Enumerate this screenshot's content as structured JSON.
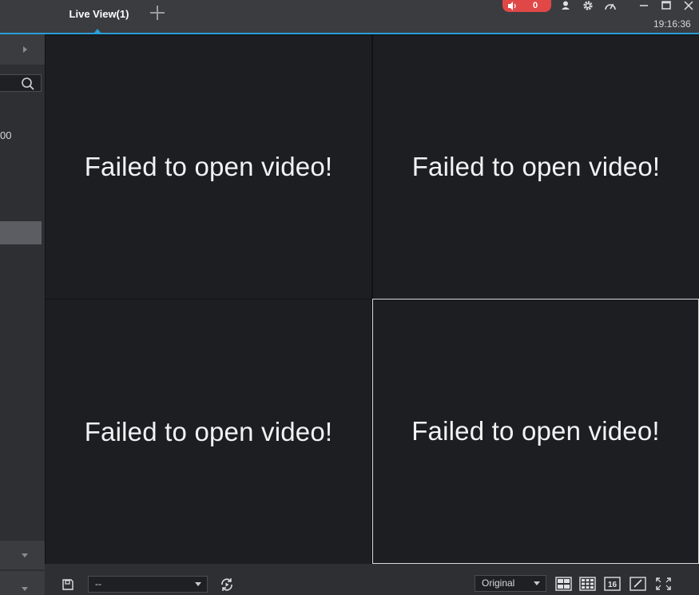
{
  "titlebar": {
    "tab_label": "Live View(1)",
    "alarm_count": "0",
    "clock": "19:16:36"
  },
  "left_panel": {
    "tree_item_text": "00"
  },
  "video_cells": [
    {
      "message": "Failed to open video!"
    },
    {
      "message": "Failed to open video!"
    },
    {
      "message": "Failed to open video!"
    },
    {
      "message": "Failed to open video!"
    }
  ],
  "bottom_bar": {
    "view_select_value": "--",
    "stream_select_value": "Original",
    "layout_16_label": "16"
  },
  "colors": {
    "accent": "#2a9fd8",
    "alarm": "#e04848",
    "cell_bg": "#1c1e22"
  }
}
